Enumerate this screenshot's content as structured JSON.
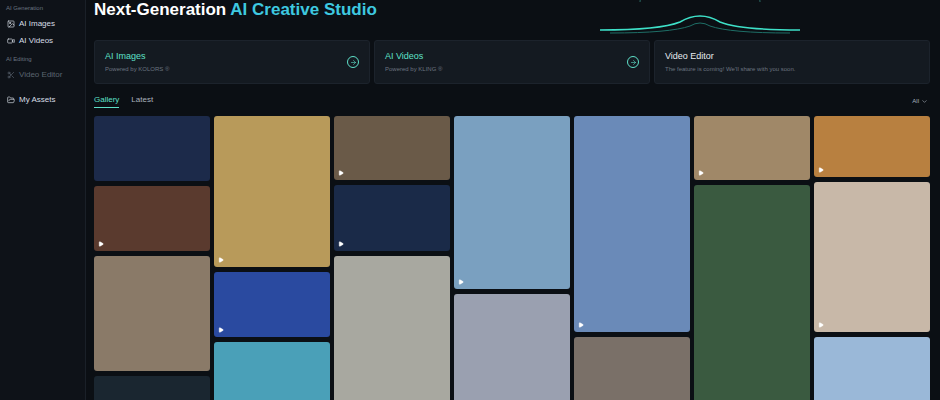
{
  "sidebar": {
    "groups": [
      {
        "heading": "AI Generation",
        "items": [
          {
            "label": "AI Images",
            "disabled": false
          },
          {
            "label": "AI Videos",
            "disabled": false
          }
        ]
      },
      {
        "heading": "AI Editing",
        "items": [
          {
            "label": "Video Editor",
            "disabled": true
          }
        ]
      }
    ],
    "footer_items": [
      {
        "label": "My Assets",
        "disabled": false
      }
    ]
  },
  "title": {
    "lead": "Next-Generation",
    "accent": "AI Creative Studio"
  },
  "cards": [
    {
      "title": "AI Images",
      "subtitle": "Powered by KOLORS ®",
      "available": true
    },
    {
      "title": "AI Videos",
      "subtitle": "Powered by KLING ®",
      "available": true
    },
    {
      "title": "Video Editor",
      "subtitle": "The feature is coming! We'll share with you soon.",
      "available": false
    }
  ],
  "tabs": [
    {
      "label": "Gallery",
      "selected": true
    },
    {
      "label": "Latest",
      "selected": false
    }
  ],
  "filter": {
    "label": "All"
  },
  "gallery": [
    [
      {
        "color": "#1c2a4a",
        "video": false
      },
      {
        "color": "#5a3a2e",
        "video": true
      },
      {
        "color": "#8a7a68",
        "video": false
      },
      {
        "color": "#1a2630",
        "video": false
      }
    ],
    [
      {
        "color": "#b89a5a",
        "video": true
      },
      {
        "color": "#2a4aa0",
        "video": true
      },
      {
        "color": "#4aa0b8",
        "video": false
      }
    ],
    [
      {
        "color": "#6a5a48",
        "video": true
      },
      {
        "color": "#1a2a48",
        "video": true
      },
      {
        "color": "#a8a8a0",
        "video": false
      }
    ],
    [
      {
        "color": "#7aa0c0",
        "video": true
      },
      {
        "color": "#9aa0b0",
        "video": false
      }
    ],
    [
      {
        "color": "#6a8ab8",
        "video": true
      },
      {
        "color": "#7a7068",
        "video": false
      }
    ],
    [
      {
        "color": "#a08868",
        "video": true
      },
      {
        "color": "#3a5a40",
        "video": true
      }
    ],
    [
      {
        "color": "#b88040",
        "video": true
      },
      {
        "color": "#c8b8a8",
        "video": true
      },
      {
        "color": "#9ab8d8",
        "video": false
      }
    ]
  ]
}
